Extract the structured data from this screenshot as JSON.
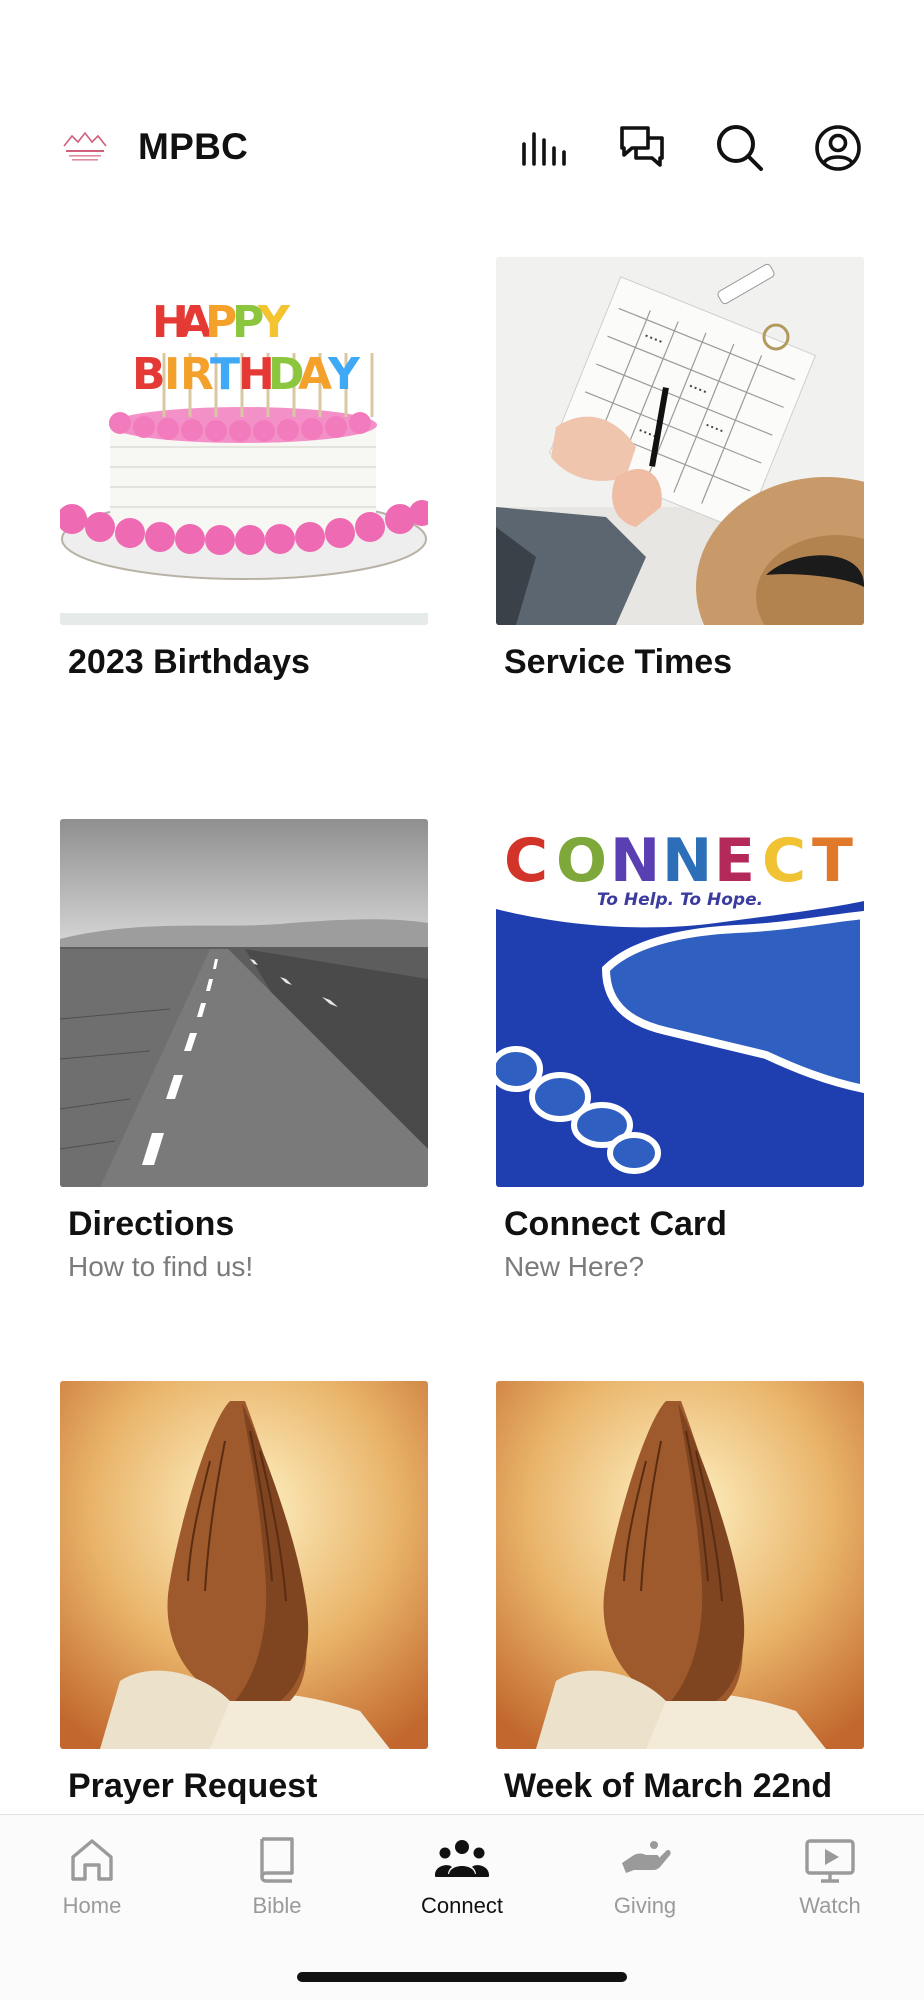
{
  "header": {
    "title": "MPBC",
    "icons": [
      "stats-icon",
      "chat-icon",
      "search-icon",
      "profile-icon"
    ]
  },
  "tiles": [
    {
      "title": "2023 Birthdays",
      "subtitle": "",
      "image": "birthday-cake"
    },
    {
      "title": "Service Times",
      "subtitle": "",
      "image": "calendar-writing"
    },
    {
      "title": "Directions",
      "subtitle": "How to find us!",
      "image": "road"
    },
    {
      "title": "Connect Card",
      "subtitle": "New Here?",
      "image": "connect-handshake",
      "image_text": {
        "headline": "CONNECT",
        "tagline": "To Help. To Hope."
      }
    },
    {
      "title": "Prayer Request",
      "subtitle": "",
      "image": "praying-hands"
    },
    {
      "title": "Week of March 22nd",
      "subtitle": "",
      "image": "praying-hands"
    }
  ],
  "tabbar": {
    "items": [
      {
        "label": "Home",
        "icon": "home-icon",
        "active": false
      },
      {
        "label": "Bible",
        "icon": "book-icon",
        "active": false
      },
      {
        "label": "Connect",
        "icon": "people-icon",
        "active": true
      },
      {
        "label": "Giving",
        "icon": "giving-hand-icon",
        "active": false
      },
      {
        "label": "Watch",
        "icon": "play-screen-icon",
        "active": false
      }
    ]
  },
  "colors": {
    "text": "#111111",
    "subtext": "#7b7b7b",
    "inactive_tab": "#9a9a9a",
    "connect_blue": "#1f3fb0"
  }
}
